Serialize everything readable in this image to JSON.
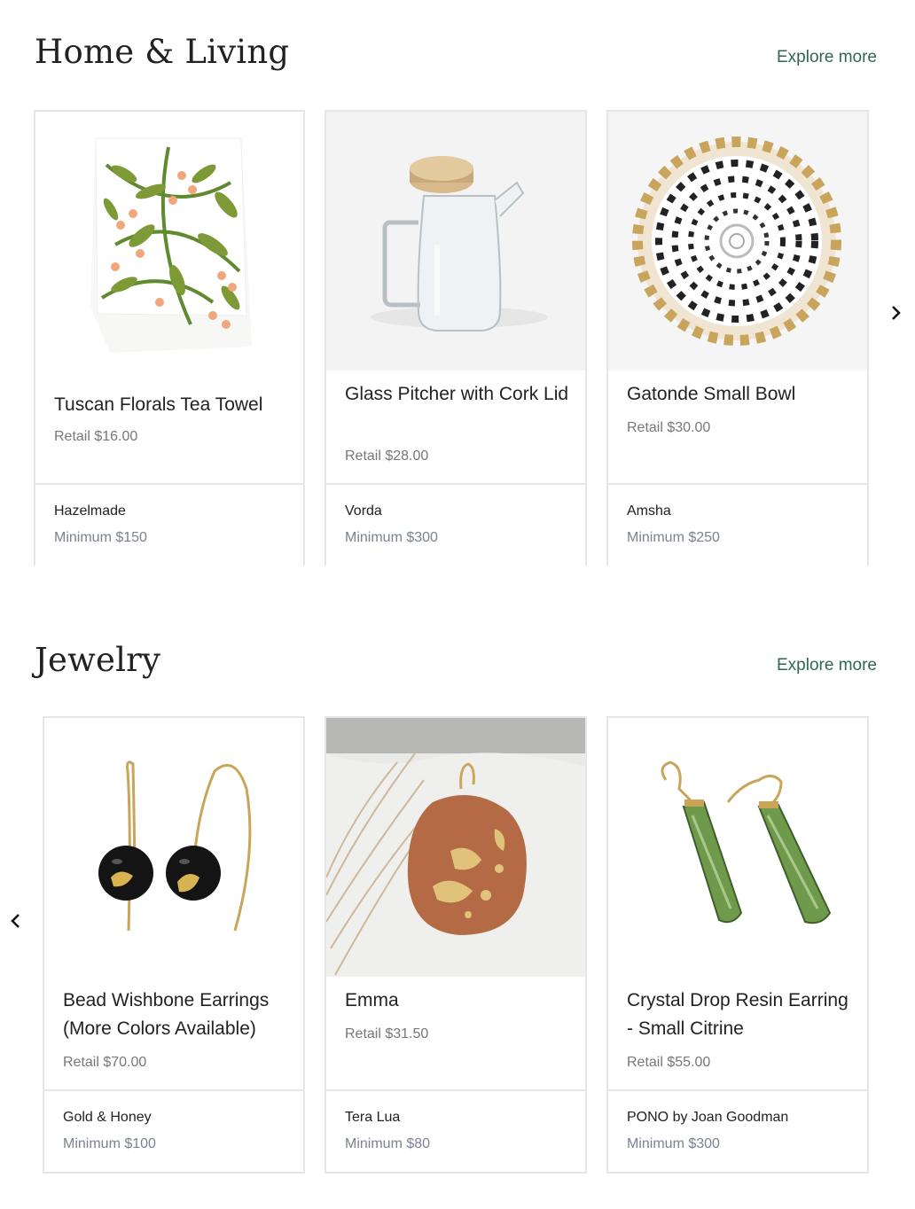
{
  "sections": [
    {
      "title": "Home & Living",
      "explore_label": "Explore more",
      "products": [
        {
          "name": "Tuscan Florals Tea Towel",
          "retail": "Retail $16.00",
          "brand": "Hazelmade",
          "minimum": "Minimum $150"
        },
        {
          "name": "Glass Pitcher with Cork Lid",
          "retail": "Retail $28.00",
          "brand": "Vorda",
          "minimum": "Minimum $300"
        },
        {
          "name": "Gatonde Small Bowl",
          "retail": "Retail $30.00",
          "brand": "Amsha",
          "minimum": "Minimum $250"
        }
      ]
    },
    {
      "title": "Jewelry",
      "explore_label": "Explore more",
      "products": [
        {
          "name": "Bead Wishbone Earrings (More Colors Available)",
          "retail": "Retail $70.00",
          "brand": "Gold & Honey",
          "minimum": "Minimum $100"
        },
        {
          "name": "Emma",
          "retail": "Retail $31.50",
          "brand": "Tera Lua",
          "minimum": "Minimum $80"
        },
        {
          "name": "Crystal Drop Resin Earring - Small Citrine",
          "retail": "Retail $55.00",
          "brand": "PONO by Joan Goodman",
          "minimum": "Minimum $300"
        }
      ]
    }
  ],
  "icons": {
    "next": "chevron-right-icon",
    "prev": "chevron-left-icon"
  },
  "colors": {
    "link": "#2f6655",
    "border": "#e6e6e6",
    "muted": "#7a8290"
  }
}
